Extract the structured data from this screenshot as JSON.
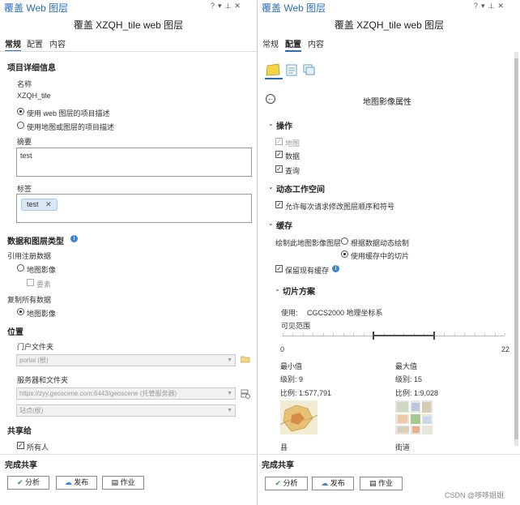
{
  "left": {
    "pane_title": "覆盖 Web 图层",
    "layer_title": "覆盖 XZQH_tile web 图层",
    "tabs": [
      "常规",
      "配置",
      "内容"
    ],
    "item_details": {
      "header": "项目详细信息",
      "name_label": "名称",
      "name_value": "XZQH_tile",
      "radio_web": "使用 web 图层的项目描述",
      "radio_map": "使用地图或图层的项目描述",
      "summary_label": "摘要",
      "summary_value": "test",
      "tags_label": "标签",
      "tag_value": "test"
    },
    "data_layer_type": {
      "header": "数据和图层类型",
      "ref_label": "引用注册数据",
      "ref_radio": "地图影像",
      "ref_check": "要素",
      "copy_label": "复制所有数据",
      "copy_radio": "地图影像"
    },
    "location": {
      "header": "位置",
      "portal_folder_label": "门户文件夹",
      "portal_folder_value": "portal (根)",
      "server_label": "服务器和文件夹",
      "server_value": "https://zyy.geoscene.com:6443/geoscene (托管服务器)",
      "site_value": "站点(根)"
    },
    "share": {
      "header": "共享给",
      "everyone": "所有人"
    },
    "finish": {
      "header": "完成共享",
      "analyze": "分析",
      "publish": "发布",
      "jobs": "作业"
    }
  },
  "right": {
    "pane_title": "覆盖 Web 图层",
    "layer_title": "覆盖 XZQH_tile web 图层",
    "tabs": [
      "常规",
      "配置",
      "内容"
    ],
    "props_title": "地图影像属性",
    "ops": {
      "header": "操作",
      "map": "地图",
      "data": "数据",
      "query": "查询"
    },
    "dynamic": {
      "header": "动态工作空间",
      "allow": "允许每次请求修改图层顺序和符号"
    },
    "cache": {
      "header": "缓存",
      "draw_label": "绘制此地图影像图层",
      "opt_dynamic": "根据数据动态绘制",
      "opt_cache": "使用缓存中的切片",
      "keep": "保留现有缓存"
    },
    "tiling": {
      "header": "切片方案",
      "use_label": "使用:",
      "use_value": "CGCS2000 地理坐标系",
      "visible_range": "可见范围",
      "scale_min": "0",
      "scale_max": "22",
      "range_low": 9,
      "range_high": 15,
      "min_title": "最小值",
      "min_level": "级别: 9",
      "min_scale": "比例: 1:577,791",
      "min_thumb_label": "县",
      "max_title": "最大值",
      "max_level": "级别: 15",
      "max_scale": "比例: 1:9,028",
      "max_thumb_label": "街道"
    },
    "finish": {
      "header": "完成共享",
      "analyze": "分析",
      "publish": "发布",
      "jobs": "作业"
    }
  },
  "watermark": "CSDN @哆哆姐姐",
  "colors": {
    "accent": "#2a6ebb",
    "info": "#3a86d1",
    "tag_bg": "#d9e8f5"
  }
}
